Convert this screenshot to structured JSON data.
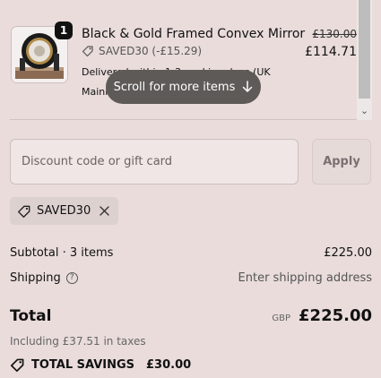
{
  "line_item": {
    "quantity": "1",
    "name": "Black & Gold Framed Convex Mirror",
    "discount_text": "SAVED30 (-£15.29)",
    "delivery_text": "Delivered within 1-3 working days (UK Mainland Only)",
    "original_price": "£130.00",
    "price": "£114.71"
  },
  "scroll_hint": {
    "label": "Scroll for more items"
  },
  "discount": {
    "placeholder": "Discount code or gift card",
    "apply_label": "Apply",
    "applied_code": "SAVED30"
  },
  "summary": {
    "subtotal_label": "Subtotal · 3 items",
    "subtotal_value": "£225.00",
    "shipping_label": "Shipping",
    "shipping_value": "Enter shipping address",
    "total_label": "Total",
    "currency": "GBP",
    "total_value": "£225.00",
    "taxes_text": "Including £37.51 in taxes",
    "savings_label": "TOTAL SAVINGS",
    "savings_value": "£30.00"
  },
  "icons": {
    "tag": "tag-icon",
    "help": "help-circle-icon",
    "close": "close-icon",
    "arrow_down": "arrow-down-icon",
    "chevron_down": "chevron-down-icon"
  },
  "colors": {
    "background": "#e9dcdb",
    "pill": "#5e5a58",
    "badge": "#111111"
  }
}
